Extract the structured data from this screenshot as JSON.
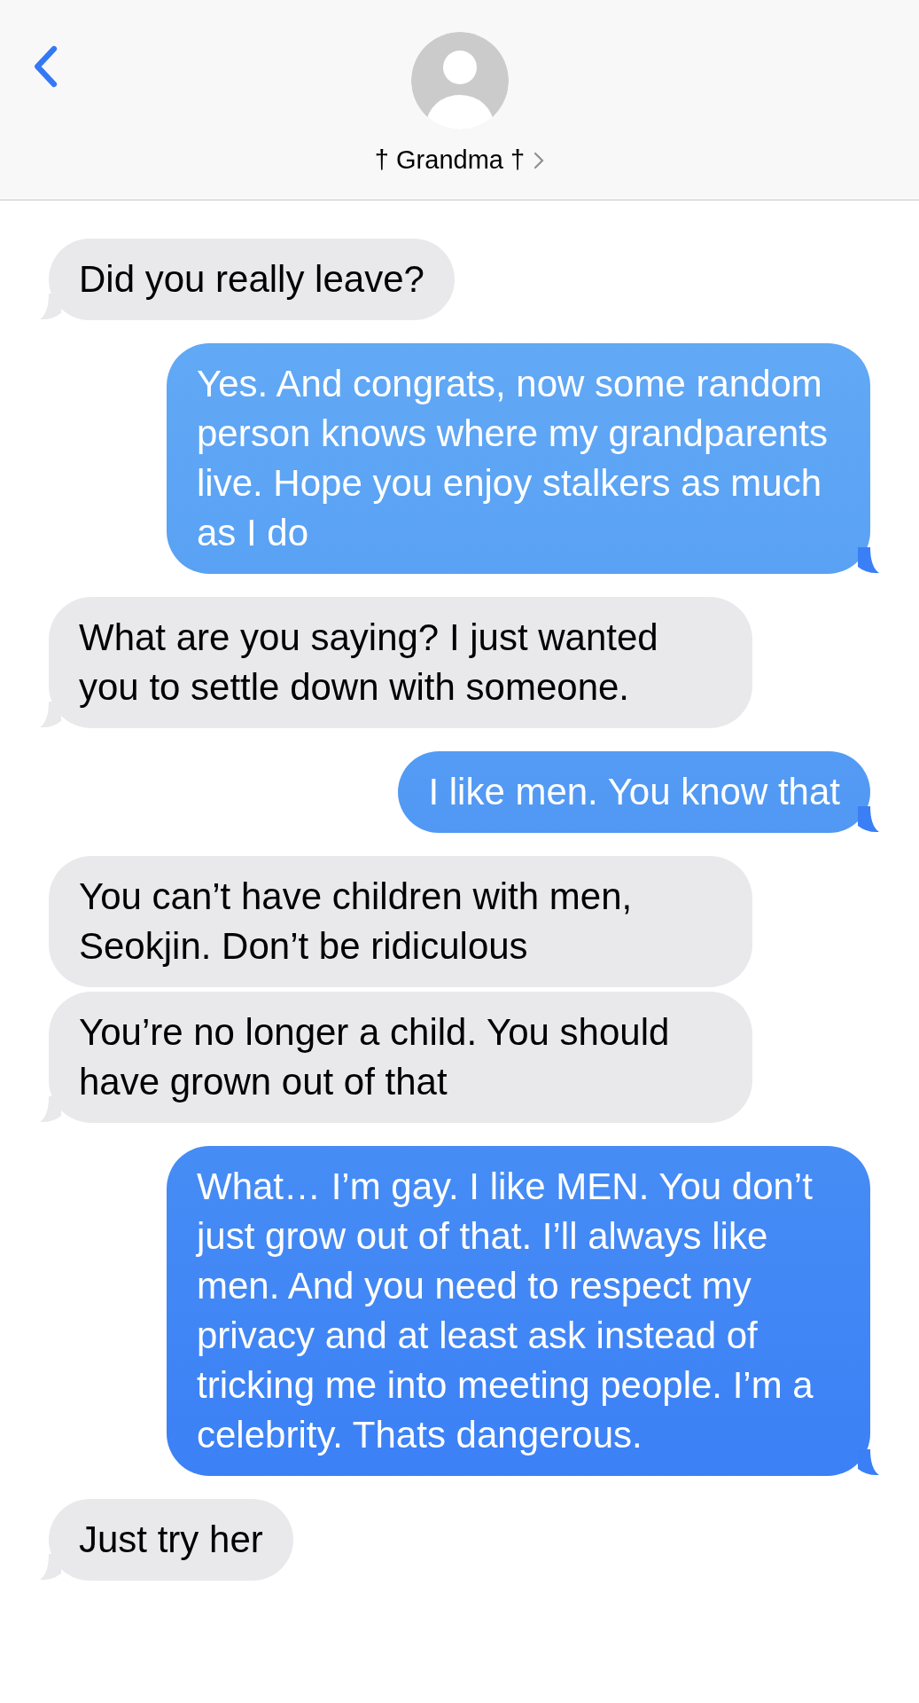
{
  "header": {
    "contact_name": "† Grandma †"
  },
  "messages": [
    {
      "kind": "received",
      "text": "Did you really leave?"
    },
    {
      "kind": "sent",
      "text": "Yes. And congrats, now some random person knows where my grandparents live. Hope you enjoy stalkers as much as I do"
    },
    {
      "kind": "received",
      "text": "What are you saying? I just wanted you to settle down with someone."
    },
    {
      "kind": "sent",
      "text": "I like men. You know that"
    },
    {
      "kind": "received",
      "text": "You can’t have children with men, Seokjin. Don’t be ridiculous"
    },
    {
      "kind": "received",
      "text": "You’re no longer a child. You should have grown out of that"
    },
    {
      "kind": "sent",
      "text": "What… I’m gay. I like MEN. You don’t just grow out of that. I’ll always like men. And you need to respect my privacy and at least ask instead of tricking me into meeting people. I’m a celebrity. Thats dangerous."
    },
    {
      "kind": "received",
      "text": "Just try her"
    }
  ]
}
